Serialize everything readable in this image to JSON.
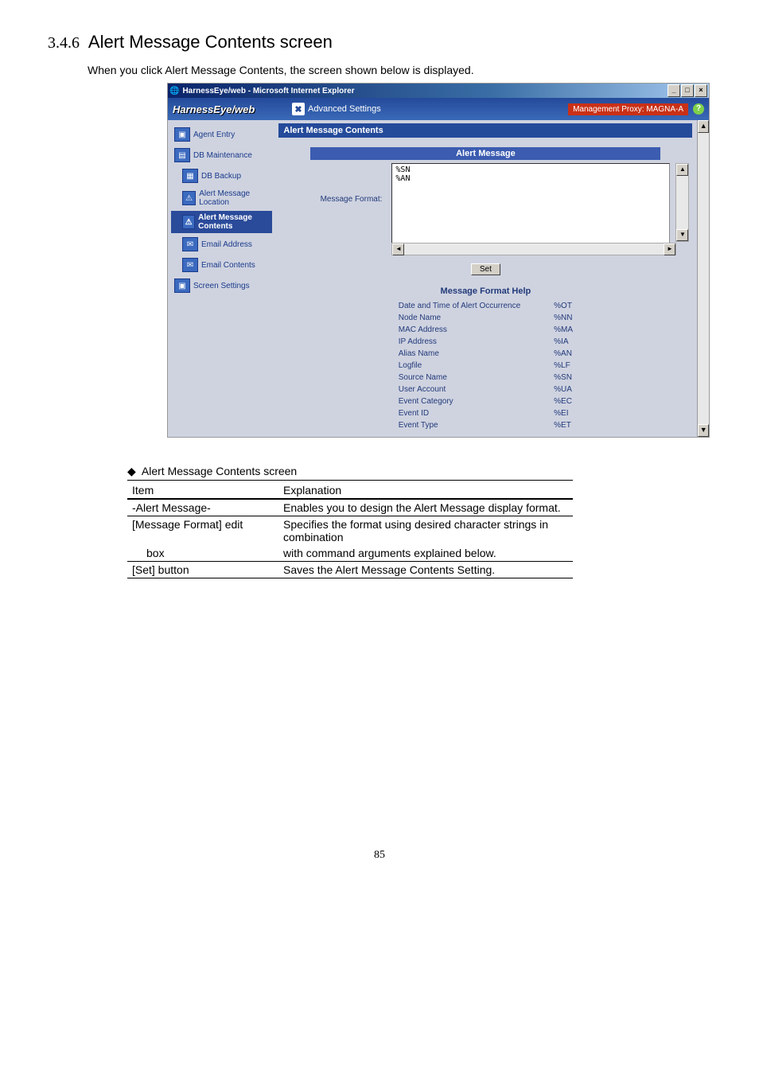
{
  "section": {
    "number": "3.4.6",
    "title": "Alert Message Contents screen"
  },
  "intro": "When you click Alert Message Contents, the screen shown below is displayed.",
  "window": {
    "title": "HarnessEye/web - Microsoft Internet Explorer",
    "app_name": "HarnessEye/web",
    "tab_label": "Advanced Settings",
    "proxy_label": "Management Proxy: MAGNA-A",
    "panel_title": "Alert Message Contents",
    "alert_message_heading": "Alert Message",
    "message_format_label": "Message Format:",
    "message_format_value": "%SN\n%AN",
    "set_button": "Set",
    "help_heading": "Message Format Help"
  },
  "sidebar": {
    "items": [
      {
        "label": "Agent Entry"
      },
      {
        "label": "DB Maintenance"
      },
      {
        "label": "DB Backup"
      },
      {
        "label": "Alert Message Location"
      },
      {
        "label": "Alert Message Contents"
      },
      {
        "label": "Email Address"
      },
      {
        "label": "Email Contents"
      },
      {
        "label": "Screen Settings"
      }
    ]
  },
  "help_rows": [
    {
      "desc": "Date and Time of Alert Occurrence",
      "code": "%OT"
    },
    {
      "desc": "Node Name",
      "code": "%NN"
    },
    {
      "desc": "MAC Address",
      "code": "%MA"
    },
    {
      "desc": "IP Address",
      "code": "%IA"
    },
    {
      "desc": "Alias Name",
      "code": "%AN"
    },
    {
      "desc": "Logfile",
      "code": "%LF"
    },
    {
      "desc": "Source Name",
      "code": "%SN"
    },
    {
      "desc": "User Account",
      "code": "%UA"
    },
    {
      "desc": "Event Category",
      "code": "%EC"
    },
    {
      "desc": "Event ID",
      "code": "%EI"
    },
    {
      "desc": "Event Type",
      "code": "%ET"
    }
  ],
  "desc_heading": "Alert Message Contents screen",
  "expl": {
    "head_item": "Item",
    "head_expl": "Explanation",
    "rows": [
      {
        "item": "-Alert Message-",
        "expl": "Enables you to design the Alert Message display format."
      },
      {
        "item": "[Message Format] edit",
        "expl": "Specifies the format using desired character strings in combination"
      },
      {
        "item_indent": "box",
        "expl": "with command arguments explained below."
      },
      {
        "item": "[Set] button",
        "expl": "Saves the Alert Message Contents Setting."
      }
    ]
  },
  "page_number": "85"
}
